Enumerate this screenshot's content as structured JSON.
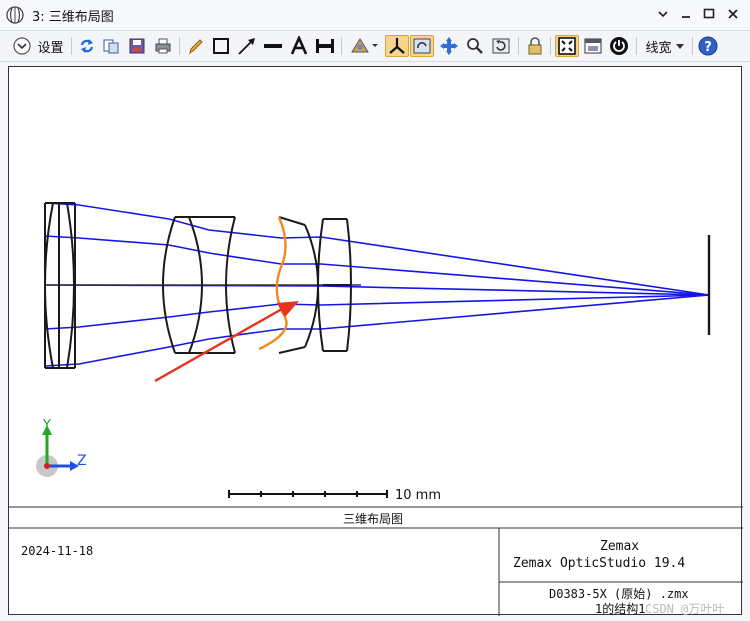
{
  "window": {
    "title": "3: 三维布局图",
    "controls": [
      "chevron-down",
      "minimize",
      "maximize",
      "close"
    ]
  },
  "toolbar": {
    "settings_label": "设置",
    "linewidth_label": "线宽",
    "help_symbol": "?",
    "tools": [
      "refresh",
      "copy",
      "save",
      "print",
      "pencil",
      "rectangle",
      "arrow",
      "line",
      "text",
      "dimension",
      "rotate-view",
      "axis",
      "rotate-rect",
      "pan",
      "zoom",
      "reset-view",
      "lock",
      "fit",
      "layout-window",
      "power"
    ],
    "active_tools": [
      "axis",
      "fit"
    ]
  },
  "plot": {
    "axis_y_label": "Y",
    "axis_z_label": "Z",
    "scale_label": "10 mm",
    "ray_color": "#1515e8",
    "highlight_surface_color": "#f08a1c",
    "annotation_arrow_color": "#e8331c",
    "lens_color": "#1a1a1a"
  },
  "footer": {
    "title": "三维布局图",
    "date": "2024-11-18",
    "company": "Zemax",
    "product": "Zemax OpticStudio 19.4",
    "filename": "D0383-5X (原始) .zmx",
    "config": "1的结构1",
    "watermark": "CSDN @万叶叶"
  }
}
